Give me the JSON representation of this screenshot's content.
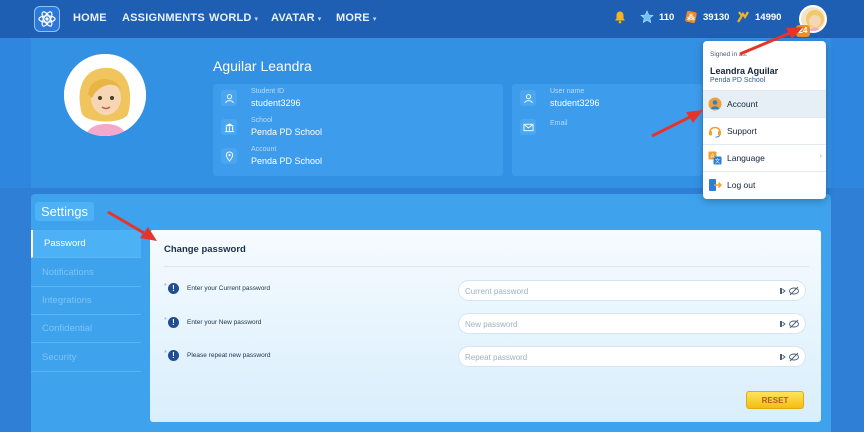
{
  "nav": {
    "items": [
      {
        "label": "HOME"
      },
      {
        "label": "ASSIGNMENTS"
      },
      {
        "label": "WORLD"
      },
      {
        "label": "AVATAR"
      },
      {
        "label": "MORE"
      }
    ],
    "stats": [
      {
        "icon": "bell-icon",
        "value": ""
      },
      {
        "icon": "star-icon",
        "value": "110"
      },
      {
        "icon": "coin-icon",
        "value": "39130"
      },
      {
        "icon": "xp-icon",
        "value": "14990"
      }
    ],
    "level_badge": "24"
  },
  "profile": {
    "name": "Aguilar Leandra",
    "left_card": [
      {
        "icon": "person-icon",
        "label": "Student ID",
        "value": "student3296"
      },
      {
        "icon": "school-icon",
        "label": "School",
        "value": "Penda PD School"
      },
      {
        "icon": "location-icon",
        "label": "Account",
        "value": "Penda PD School"
      }
    ],
    "right_card": [
      {
        "icon": "person-icon",
        "label": "User name",
        "value": "student3296"
      },
      {
        "icon": "mail-icon",
        "label": "Email",
        "value": ""
      }
    ]
  },
  "settings": {
    "title": "Settings",
    "sidebar": [
      {
        "label": "Password",
        "active": true
      },
      {
        "label": "Notifications",
        "active": false
      },
      {
        "label": "Integrations",
        "active": false
      },
      {
        "label": "Confidential",
        "active": false
      },
      {
        "label": "Security",
        "active": false
      }
    ],
    "panel": {
      "title": "Change password",
      "rows": [
        {
          "label": "Enter your Current password",
          "placeholder": "Current password"
        },
        {
          "label": "Enter your New password",
          "placeholder": "New password"
        },
        {
          "label": "Please repeat new password",
          "placeholder": "Repeat password"
        }
      ],
      "reset_label": "RESET"
    }
  },
  "dropdown": {
    "signed_in_as": "Signed in as:",
    "name": "Leandra Aguilar",
    "school": "Penda PD School",
    "items": [
      {
        "label": "Account",
        "icon": "account-icon",
        "color": "#f0a030"
      },
      {
        "label": "Support",
        "icon": "headset-icon",
        "color": "#f0a030"
      },
      {
        "label": "Language",
        "icon": "translate-icon",
        "color": "#f0a030"
      },
      {
        "label": "Log out",
        "icon": "logout-icon",
        "color": "#2a7fd6"
      }
    ]
  },
  "colors": {
    "nav_bg": "#1f5fb3",
    "page_bg": "#2f7fd6",
    "accent_yellow": "#f3bd14",
    "arrow_red": "#e5352a"
  }
}
